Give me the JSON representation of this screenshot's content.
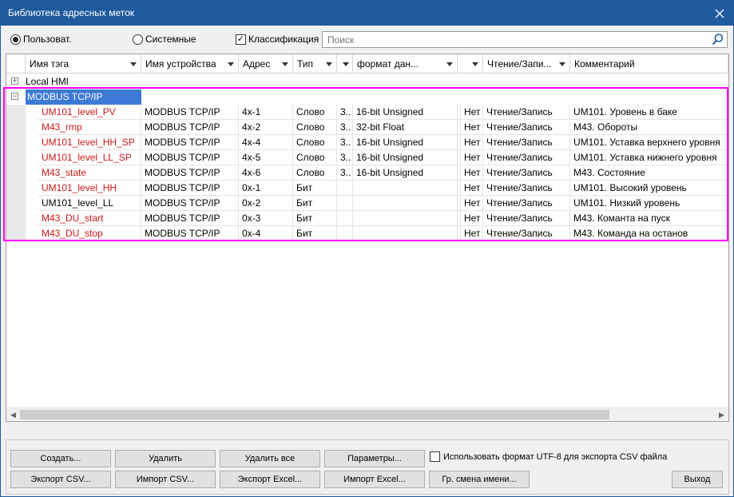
{
  "window": {
    "title": "Библиотека адресных меток"
  },
  "toolbar": {
    "radio_user": "Пользоват.",
    "radio_system": "Системные",
    "check_classify": "Классификация",
    "search_placeholder": "Поиск"
  },
  "columns": [
    "Имя тэга",
    "Имя устройства",
    "Адрес",
    "Тип",
    "",
    "формат дан...",
    "",
    "Чтение/Запи...",
    "Комментарий"
  ],
  "groups": {
    "local": "Local HMI",
    "modbus": "MODBUS TCP/IP"
  },
  "rows": [
    {
      "tag": "UM101_level_PV",
      "device": "MODBUS TCP/IP",
      "address": "4x-1",
      "type": "Слово",
      "c5": "3..",
      "format": "16-bit Unsigned",
      "c7": "Нет",
      "rw": "Чтение/Запись",
      "comment": "UM101. Уровень в баке",
      "red": true
    },
    {
      "tag": "M43_rmp",
      "device": "MODBUS TCP/IP",
      "address": "4x-2",
      "type": "Слово",
      "c5": "3..",
      "format": "32-bit Float",
      "c7": "Нет",
      "rw": "Чтение/Запись",
      "comment": "M43. Обороты",
      "red": true
    },
    {
      "tag": "UM101_level_HH_SP",
      "device": "MODBUS TCP/IP",
      "address": "4x-4",
      "type": "Слово",
      "c5": "3..",
      "format": "16-bit Unsigned",
      "c7": "Нет",
      "rw": "Чтение/Запись",
      "comment": "UM101. Уставка верхнего уровня",
      "red": true
    },
    {
      "tag": "UM101_level_LL_SP",
      "device": "MODBUS TCP/IP",
      "address": "4x-5",
      "type": "Слово",
      "c5": "3..",
      "format": "16-bit Unsigned",
      "c7": "Нет",
      "rw": "Чтение/Запись",
      "comment": "UM101. Уставка нижнего уровня",
      "red": true
    },
    {
      "tag": "M43_state",
      "device": "MODBUS TCP/IP",
      "address": "4x-6",
      "type": "Слово",
      "c5": "3..",
      "format": "16-bit Unsigned",
      "c7": "Нет",
      "rw": "Чтение/Запись",
      "comment": "M43. Состояние",
      "red": true
    },
    {
      "tag": "UM101_level_HH",
      "device": "MODBUS TCP/IP",
      "address": "0x-1",
      "type": "Бит",
      "c5": "",
      "format": "",
      "c7": "Нет",
      "rw": "Чтение/Запись",
      "comment": "UM101. Высокий уровень",
      "red": true
    },
    {
      "tag": "UM101_level_LL",
      "device": "MODBUS TCP/IP",
      "address": "0x-2",
      "type": "Бит",
      "c5": "",
      "format": "",
      "c7": "Нет",
      "rw": "Чтение/Запись",
      "comment": "UM101. Низкий уровень",
      "red": false
    },
    {
      "tag": "M43_DU_start",
      "device": "MODBUS TCP/IP",
      "address": "0x-3",
      "type": "Бит",
      "c5": "",
      "format": "",
      "c7": "Нет",
      "rw": "Чтение/Запись",
      "comment": "M43. Команта на пуск",
      "red": true
    },
    {
      "tag": "M43_DU_stop",
      "device": "MODBUS TCP/IP",
      "address": "0x-4",
      "type": "Бит",
      "c5": "",
      "format": "",
      "c7": "Нет",
      "rw": "Чтение/Запись",
      "comment": "M43. Команда на останов",
      "red": true
    }
  ],
  "buttons": {
    "create": "Создать...",
    "delete": "Удалить",
    "delete_all": "Удалить все",
    "params": "Параметры...",
    "utf8": "Использовать формат UTF-8 для экспорта CSV файла",
    "export_csv": "Экспорт CSV...",
    "import_csv": "Импорт CSV...",
    "export_excel": "Экспорт Excel...",
    "import_excel": "Импорт Excel...",
    "rename": "Гр. смена имени...",
    "exit": "Выход"
  },
  "colors": {
    "title_bar": "#1e5a9c",
    "tag_red": "#cc1a1a",
    "highlight": "#ff00ff",
    "group_selected": "#3d7ad6"
  }
}
